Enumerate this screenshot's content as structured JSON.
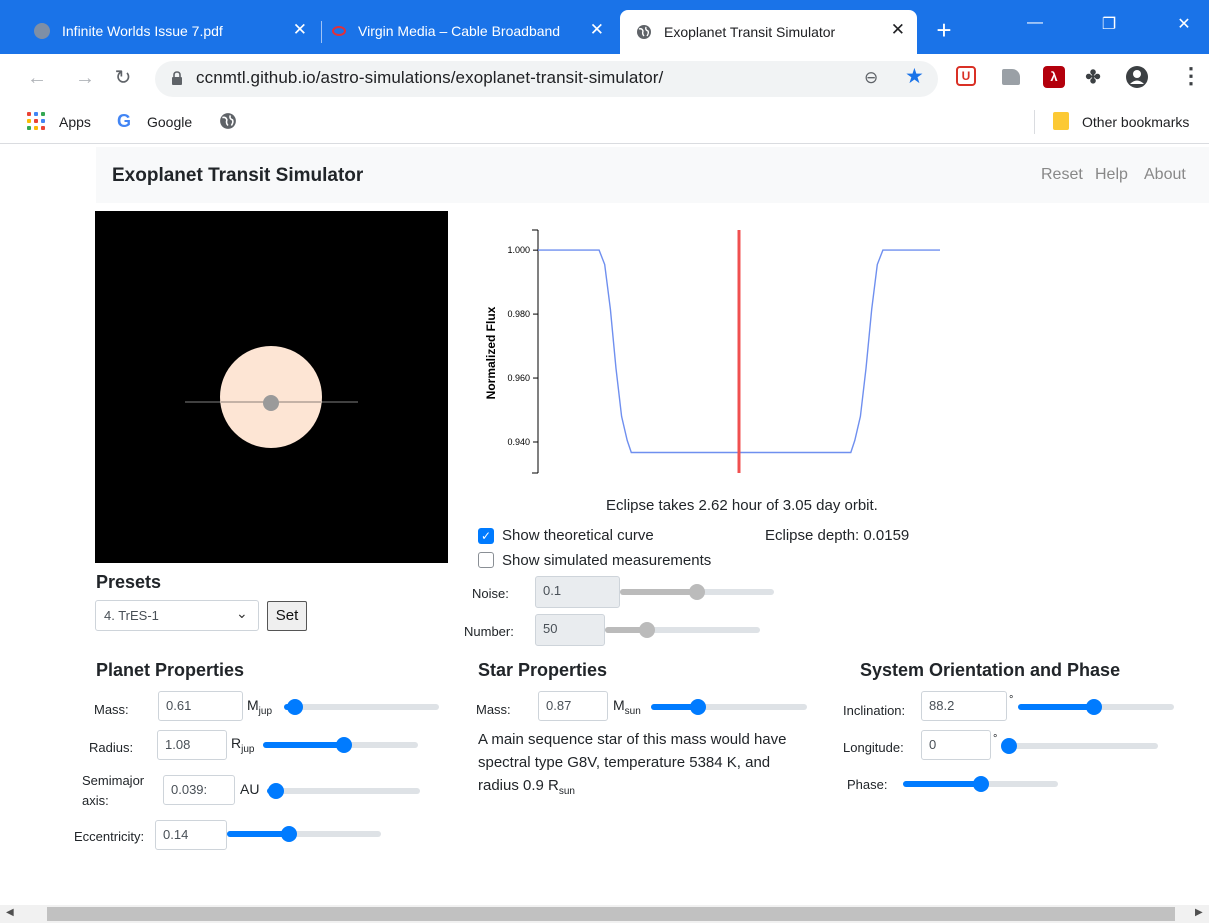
{
  "browser": {
    "tabs": [
      {
        "title": "Infinite Worlds Issue 7.pdf"
      },
      {
        "title": "Virgin Media – Cable Broadband"
      },
      {
        "title": "Exoplanet Transit Simulator"
      }
    ],
    "close_glyph": "✕",
    "new_tab_glyph": "+",
    "url": "ccnmtl.github.io/astro-simulations/exoplanet-transit-simulator/",
    "bookmarks": {
      "apps": "Apps",
      "google": "Google",
      "other": "Other bookmarks"
    }
  },
  "navbar": {
    "title": "Exoplanet Transit Simulator",
    "links": [
      "Reset",
      "Help",
      "About"
    ]
  },
  "chart_data": {
    "type": "line",
    "ylabel": "Normalized Flux",
    "yticks": [
      "1.000",
      "0.980",
      "0.960",
      "0.940"
    ],
    "ytick_values": [
      1.0,
      0.98,
      0.96,
      0.94
    ],
    "ylim": [
      0.9303,
      1.0063
    ],
    "xlim": [
      0,
      1
    ],
    "series": [
      {
        "color": "#6f8fef",
        "x": [
          0,
          0.152,
          0.166,
          0.18,
          0.194,
          0.208,
          0.222,
          0.232,
          0.778,
          0.788,
          0.802,
          0.816,
          0.83,
          0.844,
          0.858,
          1
        ],
        "y": [
          1.0,
          1.0,
          0.9955,
          0.9815,
          0.963,
          0.948,
          0.9405,
          0.9367,
          0.9367,
          0.9405,
          0.948,
          0.963,
          0.9815,
          0.9955,
          1.0,
          1.0
        ]
      }
    ],
    "marker": {
      "x": 0.5,
      "color": "#f05050"
    }
  },
  "info": {
    "eclipse_text": "Eclipse takes 2.62 hour of 3.05 day orbit.",
    "show_theoretical": "Show theoretical curve",
    "eclipse_depth": "Eclipse depth: 0.0159",
    "show_simulated": "Show simulated measurements",
    "noise_label": "Noise:",
    "noise_value": "0.1",
    "noise_level": 0.5,
    "number_label": "Number:",
    "number_value": "50",
    "number_level": 0.27
  },
  "presets": {
    "heading": "Presets",
    "selected": "4. TrES-1",
    "set_label": "Set"
  },
  "planet": {
    "heading": "Planet Properties",
    "mass_label": "Mass:",
    "mass_value": "0.61",
    "mass_unit": "M",
    "mass_sub": "jup",
    "mass_level": 0.07,
    "radius_label": "Radius:",
    "radius_value": "1.08",
    "radius_unit": "R",
    "radius_sub": "jup",
    "radius_level": 0.52,
    "semimajor_label1": "Semimajor",
    "semimajor_label2": "axis:",
    "semimajor_value": "0.039:",
    "semimajor_unit": "AU",
    "semimajor_level": 0.06,
    "ecc_label": "Eccentricity:",
    "ecc_value": "0.14",
    "ecc_level": 0.4
  },
  "star": {
    "heading": "Star Properties",
    "mass_label": "Mass:",
    "mass_value": "0.87",
    "mass_unit": "M",
    "mass_sub": "sun",
    "mass_level": 0.3,
    "desc1": "A main sequence star of this mass would have",
    "desc2": "spectral type G8V, temperature 5384 K, and",
    "desc3": "radius 0.9 R",
    "desc_sub": "sun"
  },
  "orientation": {
    "heading": "System Orientation and Phase",
    "incl_label": "Inclination:",
    "incl_value": "88.2",
    "incl_unit": "°",
    "incl_level": 0.49,
    "long_label": "Longitude:",
    "long_value": "0",
    "long_unit": "°",
    "long_level": 0.04,
    "phase_label": "Phase:",
    "phase_level": 0.5
  }
}
